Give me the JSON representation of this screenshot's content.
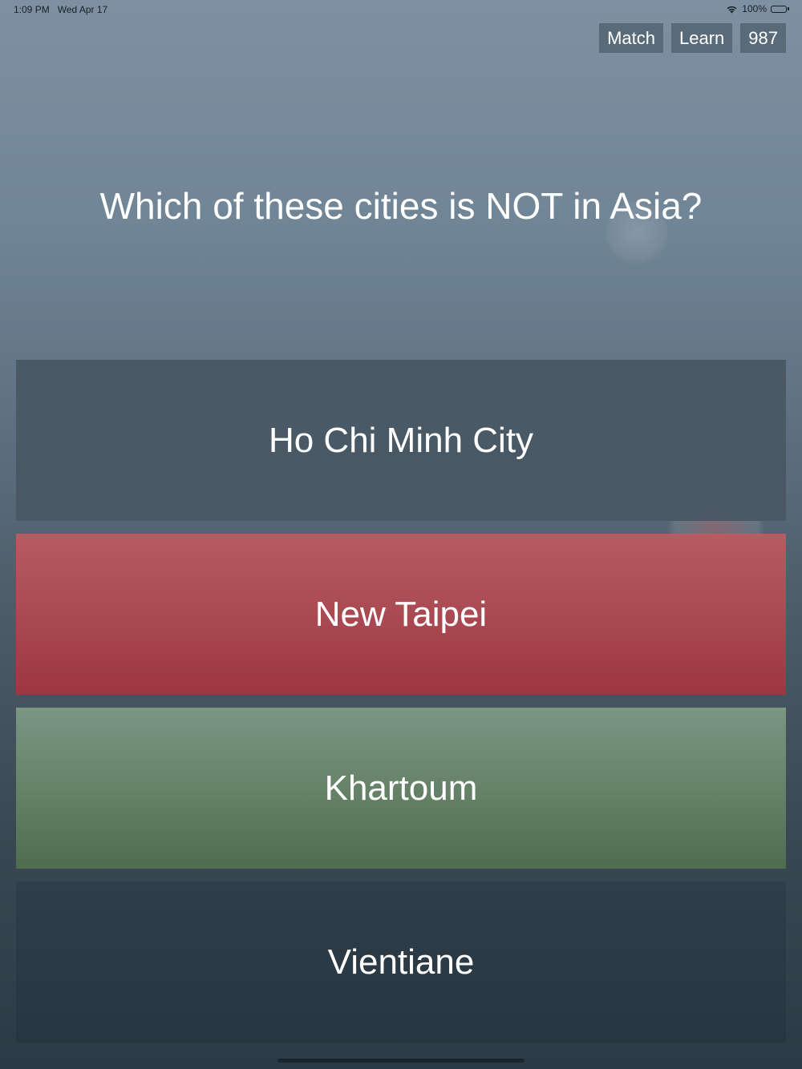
{
  "status_bar": {
    "time": "1:09 PM",
    "date": "Wed Apr 17",
    "battery_percent": "100%",
    "wifi_icon": "wifi-icon",
    "battery_icon": "battery-icon"
  },
  "nav": {
    "match_label": "Match",
    "learn_label": "Learn",
    "score": "987"
  },
  "question": "Which of these cities is NOT in Asia?",
  "answers": [
    {
      "label": "Ho Chi Minh City",
      "state": "neutral"
    },
    {
      "label": "New Taipei",
      "state": "wrong"
    },
    {
      "label": "Khartoum",
      "state": "correct"
    },
    {
      "label": "Vientiane",
      "state": "neutral"
    }
  ],
  "colors": {
    "wrong": "#a94850",
    "correct": "#648066",
    "nav_button": "#546472"
  }
}
